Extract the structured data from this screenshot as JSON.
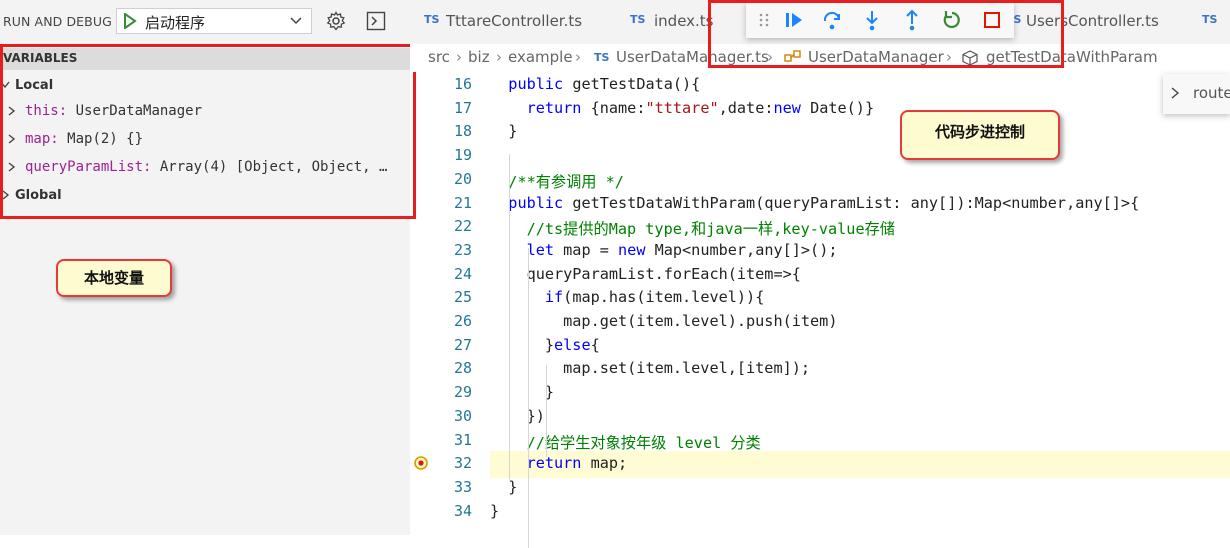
{
  "debug_header": {
    "title": "RUN AND DEBUG",
    "config_name": "启动程序"
  },
  "variables": {
    "section_title": "VARIABLES",
    "scopes": [
      {
        "name": "Local",
        "items": [
          {
            "name": "this:",
            "value": "UserDataManager"
          },
          {
            "name": "map:",
            "value": "Map(2) {}"
          },
          {
            "name": "queryParamList:",
            "value": "Array(4) [Object, Object, …"
          }
        ]
      },
      {
        "name": "Global"
      }
    ]
  },
  "annotations": {
    "local_vars": "本地变量",
    "step_control": "代码步进控制"
  },
  "tabs": [
    {
      "lang": "TS",
      "name": "TttareController.ts"
    },
    {
      "lang": "TS",
      "name": "index.ts"
    },
    {
      "lang": "TS",
      "name": "UsersController.ts"
    },
    {
      "lang": "TS",
      "name": ""
    }
  ],
  "breadcrumb": {
    "parts": [
      "src",
      "biz",
      "example"
    ],
    "file_lang": "TS",
    "file": "UserDataManager.ts",
    "class": "UserDataManager",
    "method": "getTestDataWithParam"
  },
  "peek": {
    "label": "route"
  },
  "editor": {
    "current_line": 32,
    "lines": [
      {
        "n": "16",
        "text": "  public getTestData(){"
      },
      {
        "n": "17",
        "text": "    return {name:\"tttare\",date:new Date()}"
      },
      {
        "n": "18",
        "text": "  }"
      },
      {
        "n": "19",
        "text": ""
      },
      {
        "n": "20",
        "text": "  /**有参调用 */"
      },
      {
        "n": "21",
        "text": "  public getTestDataWithParam(queryParamList: any[]):Map<number,any[]>{"
      },
      {
        "n": "22",
        "text": "    //ts提供的Map type,和java一样,key-value存储"
      },
      {
        "n": "23",
        "text": "    let map = new Map<number,any[]>();"
      },
      {
        "n": "24",
        "text": "    queryParamList.forEach(item=>{"
      },
      {
        "n": "25",
        "text": "      if(map.has(item.level)){"
      },
      {
        "n": "26",
        "text": "        map.get(item.level).push(item)"
      },
      {
        "n": "27",
        "text": "      }else{"
      },
      {
        "n": "28",
        "text": "        map.set(item.level,[item]);"
      },
      {
        "n": "29",
        "text": "      }"
      },
      {
        "n": "30",
        "text": "    })"
      },
      {
        "n": "31",
        "text": "    //给学生对象按年级 level 分类"
      },
      {
        "n": "32",
        "text": "    return map;"
      },
      {
        "n": "33",
        "text": "  }"
      },
      {
        "n": "34",
        "text": "}"
      }
    ]
  }
}
